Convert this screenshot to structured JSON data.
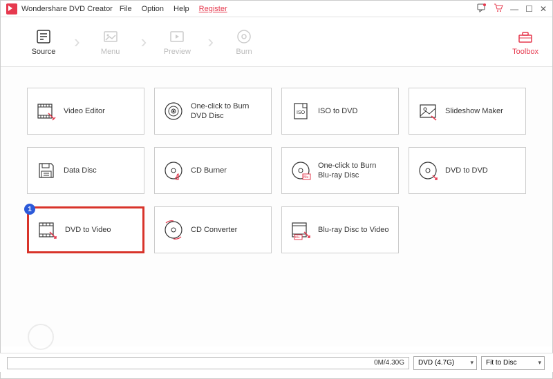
{
  "titlebar": {
    "app_name": "Wondershare DVD Creator",
    "menu": [
      "File",
      "Option",
      "Help"
    ],
    "register": "Register"
  },
  "ribbon": {
    "steps": [
      {
        "label": "Source",
        "active": true
      },
      {
        "label": "Menu",
        "active": false
      },
      {
        "label": "Preview",
        "active": false
      },
      {
        "label": "Burn",
        "active": false
      }
    ],
    "toolbox": "Toolbox"
  },
  "tools": [
    {
      "id": "video-editor",
      "label": "Video Editor",
      "icon": "film-edit"
    },
    {
      "id": "one-click-dvd",
      "label": "One-click to Burn DVD Disc",
      "icon": "disc-target"
    },
    {
      "id": "iso-to-dvd",
      "label": "ISO to DVD",
      "icon": "iso-file"
    },
    {
      "id": "slideshow",
      "label": "Slideshow Maker",
      "icon": "picture"
    },
    {
      "id": "data-disc",
      "label": "Data Disc",
      "icon": "floppy"
    },
    {
      "id": "cd-burner",
      "label": "CD Burner",
      "icon": "disc-music"
    },
    {
      "id": "one-click-bluray",
      "label": "One-click to Burn Blu-ray Disc",
      "icon": "bluray-target"
    },
    {
      "id": "dvd-to-dvd",
      "label": "DVD to DVD",
      "icon": "disc-copy"
    },
    {
      "id": "dvd-to-video",
      "label": "DVD to Video",
      "icon": "film-export",
      "highlight": true,
      "badge": "1"
    },
    {
      "id": "cd-converter",
      "label": "CD Converter",
      "icon": "disc-convert"
    },
    {
      "id": "bluray-to-video",
      "label": "Blu-ray Disc to Video",
      "icon": "bluray-export"
    }
  ],
  "statusbar": {
    "progress": "0M/4.30G",
    "disc_type": "DVD (4.7G)",
    "fit_mode": "Fit to Disc"
  }
}
